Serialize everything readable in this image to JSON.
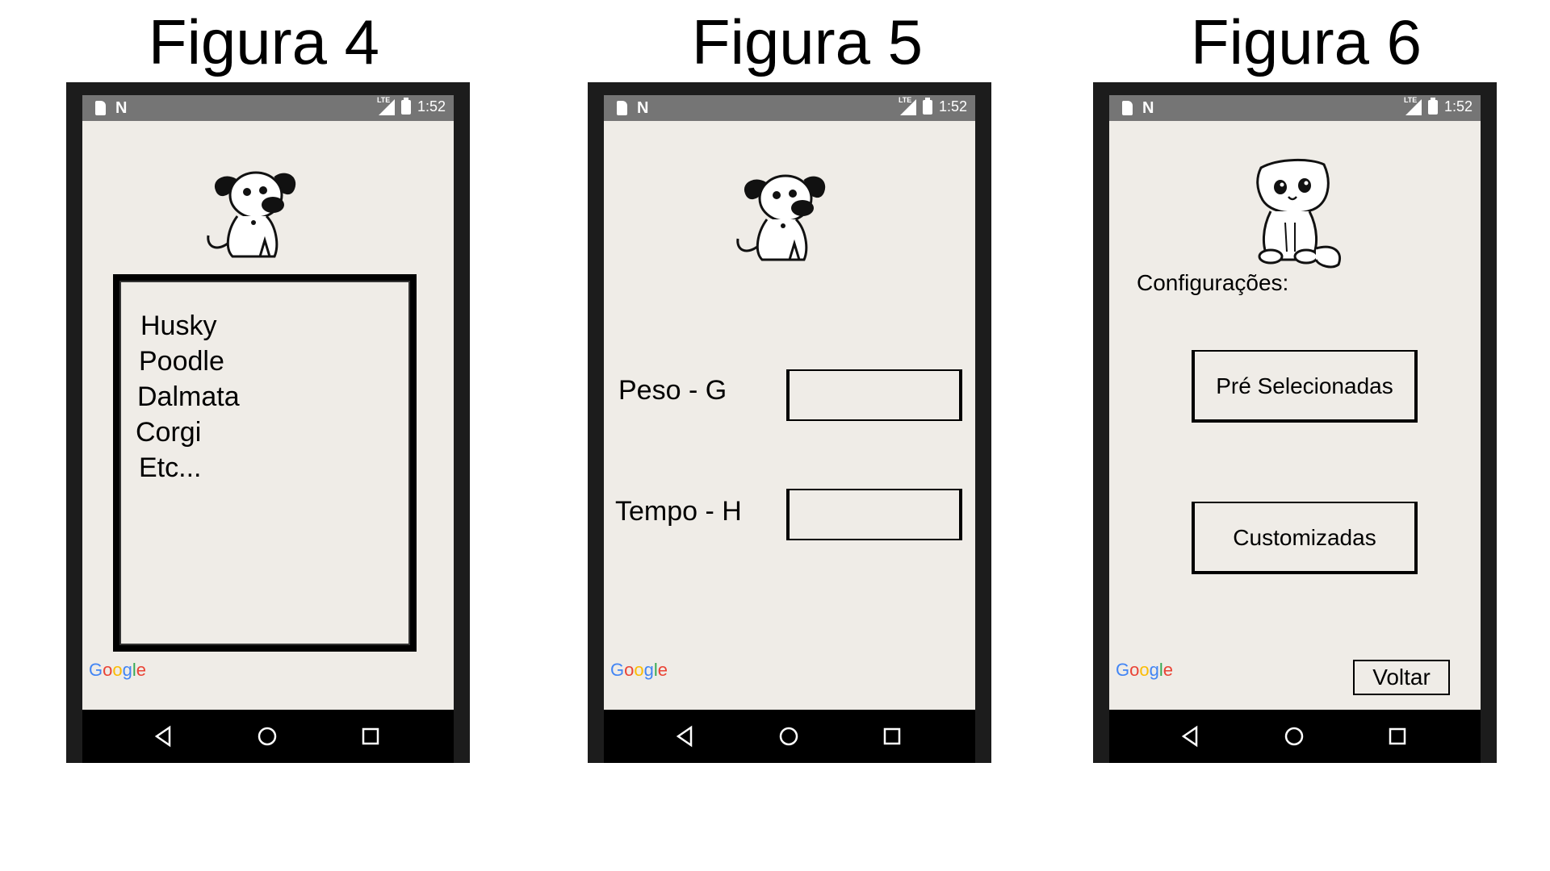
{
  "status_bar": {
    "time": "1:52",
    "network": "LTE"
  },
  "google_logo": [
    "G",
    "o",
    "o",
    "g",
    "l",
    "e"
  ],
  "figure4": {
    "title": "Figura 4",
    "breeds": [
      "Husky",
      "Poodle",
      "Dalmata",
      "Corgi",
      "Etc..."
    ]
  },
  "figure5": {
    "title": "Figura 5",
    "weight_label": "Peso - G",
    "time_label": "Tempo -  H",
    "weight_value": "",
    "time_value": ""
  },
  "figure6": {
    "title": "Figura 6",
    "config_label": "Configurações:",
    "preselected_button": "Pré Selecionadas",
    "custom_button": "Customizadas",
    "back_button": "Voltar"
  }
}
